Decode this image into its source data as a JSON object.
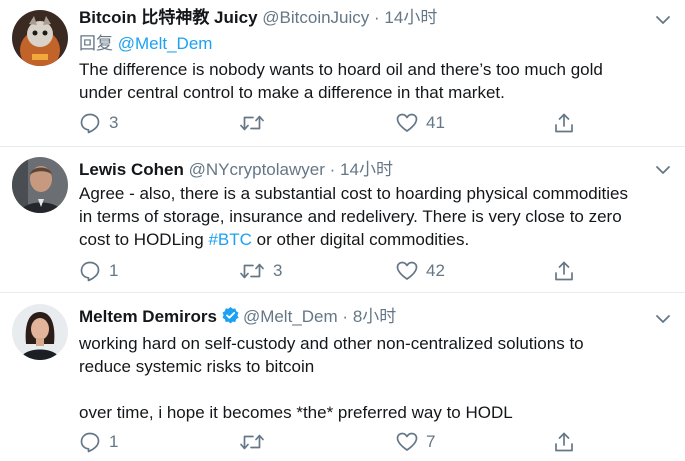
{
  "tweets": [
    {
      "name": "Bitcoin 比特神教 Juicy",
      "handle": "@BitcoinJuicy",
      "separator": "·",
      "time": "14小时",
      "reply_label": "回复",
      "reply_mention": "@Melt_Dem",
      "verified": false,
      "text_lines": [
        "The difference is nobody wants to hoard oil and there’s too much gold",
        "under central control to make a difference in that market."
      ],
      "counts": {
        "replies": "3",
        "retweets": "",
        "likes": "41"
      }
    },
    {
      "name": "Lewis Cohen",
      "handle": "@NYcryptolawyer",
      "separator": "·",
      "time": "14小时",
      "verified": false,
      "text_lines": [
        "Agree - also, there is a substantial cost to hoarding physical commodities",
        "in terms of storage, insurance and redelivery.  There is very close to zero"
      ],
      "text_last_prefix": "cost to HODLing ",
      "text_last_hashtag": "#BTC",
      "text_last_suffix": " or other digital commodities.",
      "counts": {
        "replies": "1",
        "retweets": "3",
        "likes": "42"
      }
    },
    {
      "name": "Meltem Demirors",
      "handle": "@Melt_Dem",
      "separator": "·",
      "time": "8小时",
      "verified": true,
      "text_lines": [
        "working hard on self-custody and other non-centralized solutions to",
        "reduce systemic risks to bitcoin"
      ],
      "text_para2": "over time, i hope it becomes *the* preferred way to HODL",
      "counts": {
        "replies": "1",
        "retweets": "",
        "likes": "7"
      }
    }
  ],
  "colors": {
    "accent": "#1da1f2",
    "secondary_text": "#657786",
    "primary_text": "#14171a",
    "divider": "#e6ecf0"
  },
  "icons": {
    "reply": "reply-icon",
    "retweet": "retweet-icon",
    "like": "heart-icon",
    "share": "share-icon",
    "more": "chevron-down-icon",
    "verified": "verified-badge-icon"
  }
}
